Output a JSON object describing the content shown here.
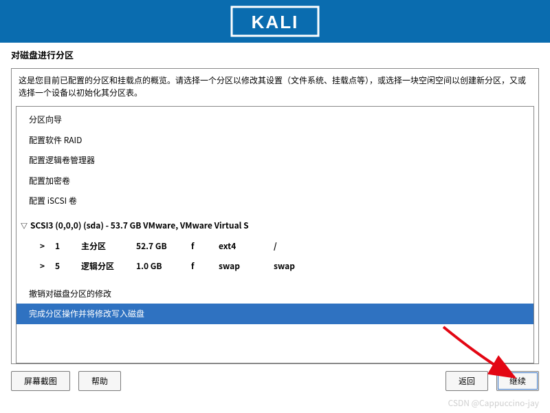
{
  "header": {
    "logo_text": "KALI"
  },
  "title": "对磁盘进行分区",
  "description": "这是您目前已配置的分区和挂载点的概览。请选择一个分区以修改其设置（文件系统、挂载点等），或选择一块空闲空间以创建新分区，又或选择一个设备以初始化其分区表。",
  "menu": {
    "guided": "分区向导",
    "raid": "配置软件 RAID",
    "lvm": "配置逻辑卷管理器",
    "crypt": "配置加密卷",
    "iscsi": "配置 iSCSI 卷"
  },
  "disk": {
    "expand_icon": "▽",
    "label": "SCSI3 (0,0,0) (sda) - 53.7 GB VMware, VMware Virtual S",
    "partitions": [
      {
        "indicator": ">",
        "num": "1",
        "type": "主分区",
        "size": "52.7 GB",
        "flag": "f",
        "fs": "ext4",
        "mount": "/"
      },
      {
        "indicator": ">",
        "num": "5",
        "type": "逻辑分区",
        "size": "1.0 GB",
        "flag": "f",
        "fs": "swap",
        "mount": "swap"
      }
    ]
  },
  "actions": {
    "undo": "撤销对磁盘分区的修改",
    "finish": "完成分区操作并将修改写入磁盘"
  },
  "buttons": {
    "screenshot": "屏幕截图",
    "help": "帮助",
    "back": "返回",
    "continue": "继续"
  },
  "watermark": "CSDN @Cappuccino-jay"
}
